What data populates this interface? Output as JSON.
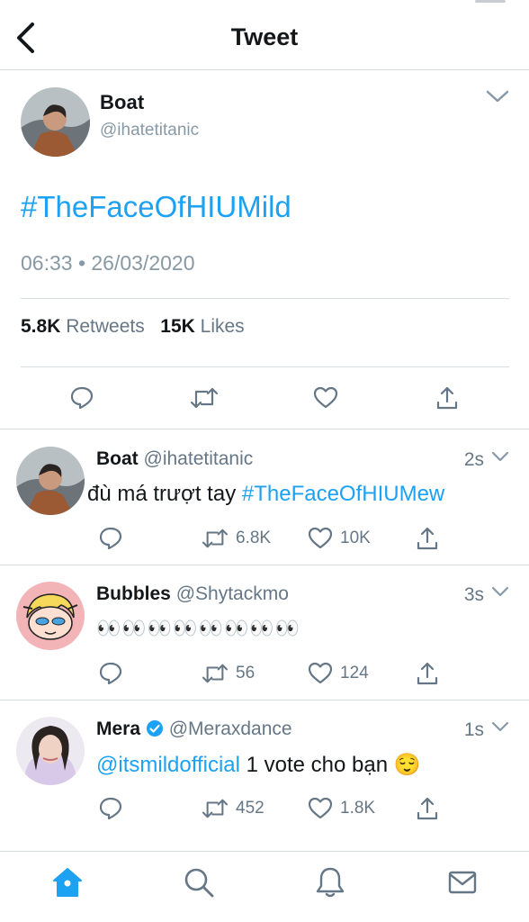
{
  "header": {
    "title": "Tweet"
  },
  "tweet": {
    "name": "Boat",
    "handle": "@ihatetitanic",
    "text": "#TheFaceOfHIUMild",
    "time": "06:33 • 26/03/2020",
    "retweets_count": "5.8K",
    "retweets_label": "Retweets",
    "likes_count": "15K",
    "likes_label": "Likes"
  },
  "replies": [
    {
      "name": "Boat",
      "handle": "@ihatetitanic",
      "time": "2s",
      "text_plain": "đù má trượt tay ",
      "text_link": "#TheFaceOfHIUMew",
      "retweets": "6.8K",
      "likes": "10K"
    },
    {
      "name": "Bubbles",
      "handle": "@Shytackmo",
      "time": "3s",
      "text_plain": "👀👀👀👀👀👀👀👀",
      "text_link": "",
      "retweets": "56",
      "likes": "124"
    },
    {
      "name": "Mera",
      "handle": "@Meraxdance",
      "time": "1s",
      "text_link": "@itsmildofficial",
      "text_plain": " 1 vote cho bạn 😌",
      "retweets": "452",
      "likes": "1.8K"
    }
  ],
  "icons": {
    "back": "chevron-left-icon",
    "caret": "chevron-down-icon",
    "reply": "reply-icon",
    "retweet": "retweet-icon",
    "like": "heart-icon",
    "share": "share-icon",
    "home": "home-icon",
    "search": "search-icon",
    "notifications": "bell-icon",
    "messages": "mail-icon"
  },
  "colors": {
    "accent": "#1da1f2",
    "muted": "#657786",
    "verified": "#1da1f2"
  }
}
